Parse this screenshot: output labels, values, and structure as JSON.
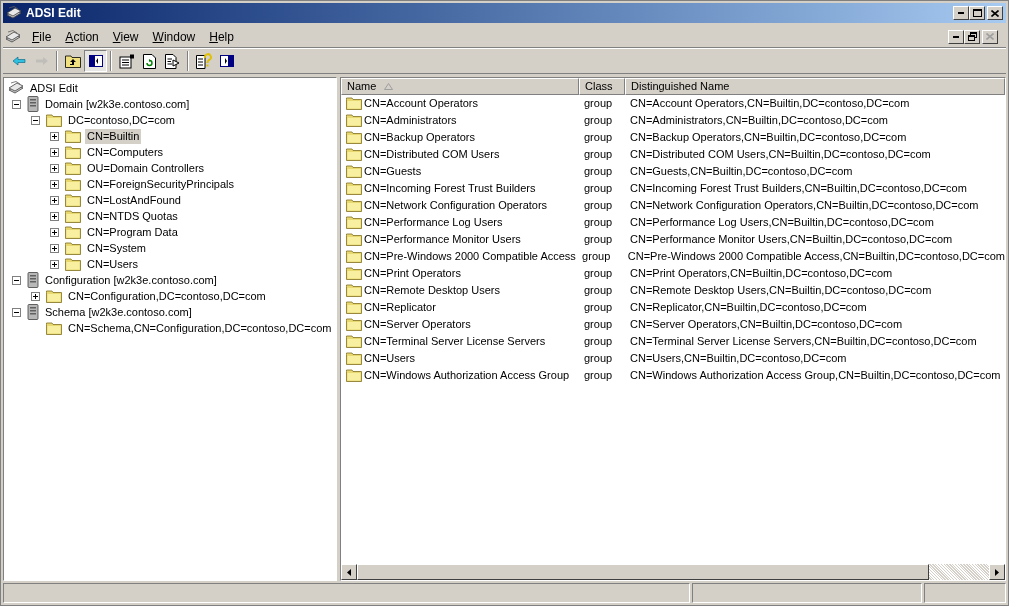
{
  "window": {
    "title": "ADSI Edit"
  },
  "menu": [
    "File",
    "Action",
    "View",
    "Window",
    "Help"
  ],
  "toolbar": [
    {
      "kind": "back",
      "pressed": false,
      "disabled": false
    },
    {
      "kind": "forward",
      "pressed": false,
      "disabled": true
    },
    {
      "kind": "up",
      "pressed": false,
      "disabled": false
    },
    {
      "kind": "tree",
      "pressed": true,
      "disabled": false
    },
    {
      "kind": "properties",
      "pressed": false,
      "disabled": false
    },
    {
      "kind": "refresh",
      "pressed": false,
      "disabled": false
    },
    {
      "kind": "export",
      "pressed": false,
      "disabled": false
    },
    {
      "kind": "help",
      "pressed": false,
      "disabled": false
    },
    {
      "kind": "actionpane",
      "pressed": false,
      "disabled": false
    }
  ],
  "tree": {
    "label": "ADSI Edit",
    "kind": "root",
    "selected": false,
    "children": [
      {
        "label": "Domain [w2k3e.contoso.com]",
        "kind": "server",
        "expanded": true,
        "selected": false,
        "children": [
          {
            "label": "DC=contoso,DC=com",
            "kind": "folder",
            "expanded": true,
            "selected": false,
            "children": [
              {
                "label": "CN=Builtin",
                "kind": "folder",
                "expanded": false,
                "selected": true
              },
              {
                "label": "CN=Computers",
                "kind": "folder",
                "expanded": false,
                "selected": false
              },
              {
                "label": "OU=Domain Controllers",
                "kind": "folder",
                "expanded": false,
                "selected": false
              },
              {
                "label": "CN=ForeignSecurityPrincipals",
                "kind": "folder",
                "expanded": false,
                "selected": false
              },
              {
                "label": "CN=LostAndFound",
                "kind": "folder",
                "expanded": false,
                "selected": false
              },
              {
                "label": "CN=NTDS Quotas",
                "kind": "folder",
                "expanded": false,
                "selected": false
              },
              {
                "label": "CN=Program Data",
                "kind": "folder",
                "expanded": false,
                "selected": false
              },
              {
                "label": "CN=System",
                "kind": "folder",
                "expanded": false,
                "selected": false
              },
              {
                "label": "CN=Users",
                "kind": "folder",
                "expanded": false,
                "selected": false
              }
            ]
          }
        ]
      },
      {
        "label": "Configuration [w2k3e.contoso.com]",
        "kind": "server",
        "expanded": true,
        "selected": false,
        "children": [
          {
            "label": "CN=Configuration,DC=contoso,DC=com",
            "kind": "folder",
            "expanded": false,
            "selected": false
          }
        ]
      },
      {
        "label": "Schema [w2k3e.contoso.com]",
        "kind": "server",
        "expanded": true,
        "selected": false,
        "children": [
          {
            "label": "CN=Schema,CN=Configuration,DC=contoso,DC=com",
            "kind": "folder",
            "selected": false
          }
        ]
      }
    ]
  },
  "table": {
    "columns": [
      {
        "label": "Name",
        "sorted": true
      },
      {
        "label": "Class",
        "sorted": false
      },
      {
        "label": "Distinguished Name",
        "sorted": false
      }
    ],
    "rows": [
      [
        "CN=Account Operators",
        "group",
        "CN=Account Operators,CN=Builtin,DC=contoso,DC=com"
      ],
      [
        "CN=Administrators",
        "group",
        "CN=Administrators,CN=Builtin,DC=contoso,DC=com"
      ],
      [
        "CN=Backup Operators",
        "group",
        "CN=Backup Operators,CN=Builtin,DC=contoso,DC=com"
      ],
      [
        "CN=Distributed COM Users",
        "group",
        "CN=Distributed COM Users,CN=Builtin,DC=contoso,DC=com"
      ],
      [
        "CN=Guests",
        "group",
        "CN=Guests,CN=Builtin,DC=contoso,DC=com"
      ],
      [
        "CN=Incoming Forest Trust Builders",
        "group",
        "CN=Incoming Forest Trust Builders,CN=Builtin,DC=contoso,DC=com"
      ],
      [
        "CN=Network Configuration Operators",
        "group",
        "CN=Network Configuration Operators,CN=Builtin,DC=contoso,DC=com"
      ],
      [
        "CN=Performance Log Users",
        "group",
        "CN=Performance Log Users,CN=Builtin,DC=contoso,DC=com"
      ],
      [
        "CN=Performance Monitor Users",
        "group",
        "CN=Performance Monitor Users,CN=Builtin,DC=contoso,DC=com"
      ],
      [
        "CN=Pre-Windows 2000 Compatible Access",
        "group",
        "CN=Pre-Windows 2000 Compatible Access,CN=Builtin,DC=contoso,DC=com"
      ],
      [
        "CN=Print Operators",
        "group",
        "CN=Print Operators,CN=Builtin,DC=contoso,DC=com"
      ],
      [
        "CN=Remote Desktop Users",
        "group",
        "CN=Remote Desktop Users,CN=Builtin,DC=contoso,DC=com"
      ],
      [
        "CN=Replicator",
        "group",
        "CN=Replicator,CN=Builtin,DC=contoso,DC=com"
      ],
      [
        "CN=Server Operators",
        "group",
        "CN=Server Operators,CN=Builtin,DC=contoso,DC=com"
      ],
      [
        "CN=Terminal Server License Servers",
        "group",
        "CN=Terminal Server License Servers,CN=Builtin,DC=contoso,DC=com"
      ],
      [
        "CN=Users",
        "group",
        "CN=Users,CN=Builtin,DC=contoso,DC=com"
      ],
      [
        "CN=Windows Authorization Access Group",
        "group",
        "CN=Windows Authorization Access Group,CN=Builtin,DC=contoso,DC=com"
      ]
    ]
  }
}
